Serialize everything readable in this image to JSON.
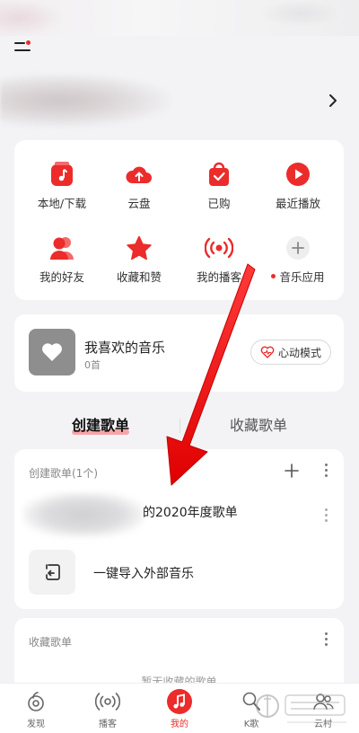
{
  "grid": {
    "items": [
      {
        "label": "本地/下载",
        "icon": "music-note-box-icon"
      },
      {
        "label": "云盘",
        "icon": "cloud-upload-icon"
      },
      {
        "label": "已购",
        "icon": "shopping-bag-check-icon"
      },
      {
        "label": "最近播放",
        "icon": "play-circle-icon"
      },
      {
        "label": "我的好友",
        "icon": "friends-icon"
      },
      {
        "label": "收藏和赞",
        "icon": "star-icon"
      },
      {
        "label": "我的播客",
        "icon": "broadcast-icon"
      },
      {
        "label": "音乐应用",
        "icon": "plus-circle-icon"
      }
    ]
  },
  "favorite": {
    "title": "我喜欢的音乐",
    "count": "0首",
    "mode_button": "心动模式"
  },
  "tabs": {
    "created": "创建歌单",
    "collected": "收藏歌单"
  },
  "created_section": {
    "header": "创建歌单(1个)",
    "playlist_title": "的2020年度歌单",
    "import_label": "一键导入外部音乐"
  },
  "collected_section": {
    "header": "收藏歌单",
    "empty_text": "暂无收藏的歌单"
  },
  "nav": {
    "items": [
      {
        "label": "发现",
        "icon": "discover-icon"
      },
      {
        "label": "播客",
        "icon": "podcast-icon"
      },
      {
        "label": "我的",
        "icon": "music-note-icon"
      },
      {
        "label": "K歌",
        "icon": "karaoke-mic-icon"
      },
      {
        "label": "云村",
        "icon": "community-icon"
      }
    ]
  },
  "colors": {
    "accent": "#ec2b2b",
    "background": "#f3f3f5",
    "card": "#ffffff"
  }
}
